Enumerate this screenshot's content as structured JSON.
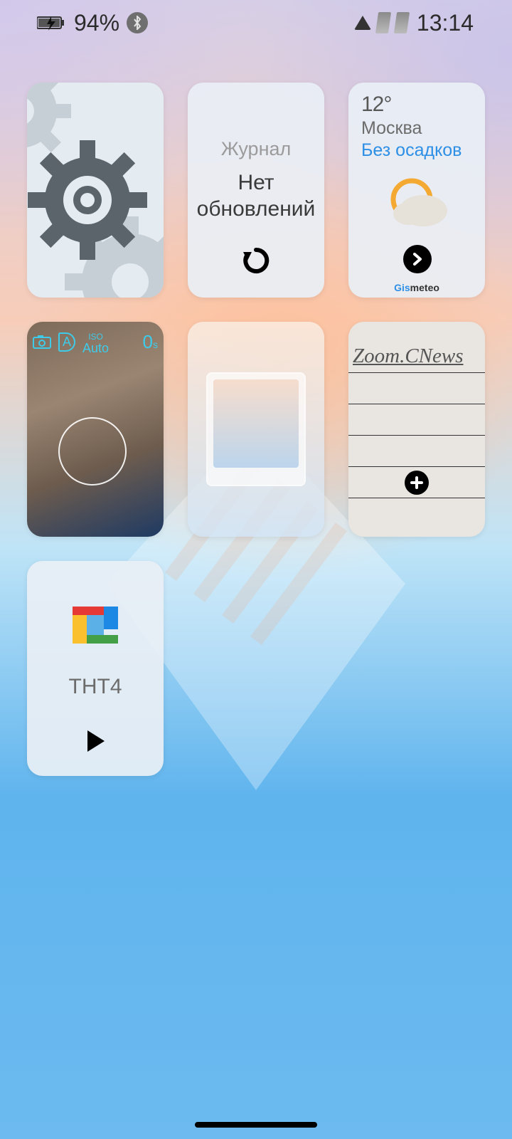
{
  "status_bar": {
    "battery_pct": "94%",
    "time": "13:14"
  },
  "widgets": {
    "journal": {
      "title": "Журнал",
      "body_line1": "Нет",
      "body_line2": "обновлений"
    },
    "weather": {
      "temp": "12°",
      "city": "Москва",
      "condition": "Без осадков",
      "brand_prefix": "Gis",
      "brand_suffix": "meteo"
    },
    "camera": {
      "mode": "A",
      "iso_label": "ISO",
      "iso_value": "Auto",
      "timer_value": "0",
      "timer_unit": "s"
    },
    "news": {
      "title": "Zoom.CNews"
    },
    "tv": {
      "channel": "ТНТ4"
    }
  }
}
